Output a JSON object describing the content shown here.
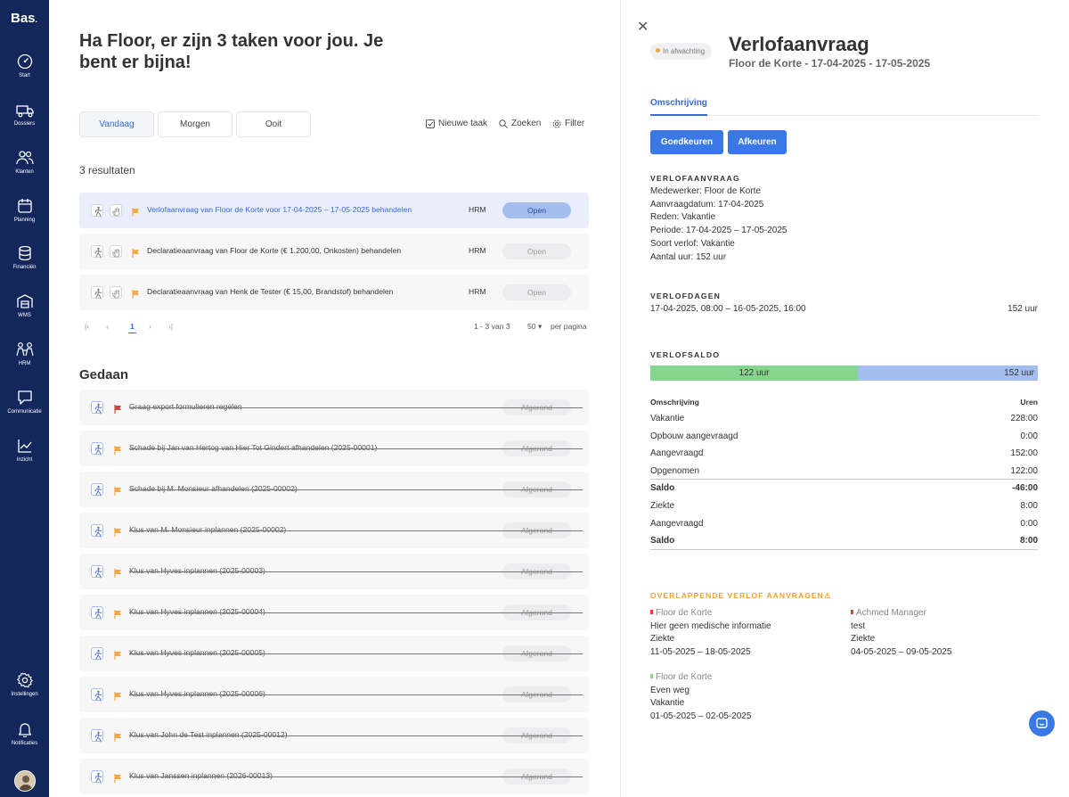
{
  "sidebar": {
    "logo": "Bas",
    "items": [
      {
        "label": "Start"
      },
      {
        "label": "Dossiers"
      },
      {
        "label": "Klanten"
      },
      {
        "label": "Planning"
      },
      {
        "label": "Financiën"
      },
      {
        "label": "WMS"
      },
      {
        "label": "HRM"
      },
      {
        "label": "Communicatie"
      },
      {
        "label": "Inzicht"
      }
    ],
    "bottom": [
      {
        "label": "Instellingen"
      },
      {
        "label": "Notificaties"
      }
    ]
  },
  "main": {
    "greeting": "Ha Floor, er zijn 3 taken voor jou. Je bent er bijna!",
    "tabs": [
      {
        "label": "Vandaag",
        "active": true
      },
      {
        "label": "Morgen",
        "active": false
      },
      {
        "label": "Ooit",
        "active": false
      }
    ],
    "tools": {
      "new_task": "Nieuwe taak",
      "search": "Zoeken",
      "filter": "Filter"
    },
    "results_label": "3 resultaten",
    "tasks": [
      {
        "title": "Verlofaanvraag van Floor de Korte voor 17-04-2025 – 17-05-2025 behandelen",
        "category": "HRM",
        "status": "Open",
        "selected": true
      },
      {
        "title": "Declaratieaanvraag van Floor de Korte (€ 1.200,00, Onkosten) behandelen",
        "category": "HRM",
        "status": "Open",
        "selected": false
      },
      {
        "title": "Declaratieaanvraag van Henk de Tester (€ 15,00, Brandstof) behandelen",
        "category": "HRM",
        "status": "Open",
        "selected": false
      }
    ],
    "pager": {
      "page": "1",
      "range": "1 - 3 van 3",
      "per_page": "50",
      "per_page_label": "per pagina"
    },
    "done_title": "Gedaan",
    "done": [
      {
        "title": "Graag export formulieren regelen",
        "status": "Afgerond",
        "flag": "#d9423a"
      },
      {
        "title": "Schade bij Jan van Hertog van Hier Tot Gindert afhandelen (2025-00001)",
        "status": "Afgerond",
        "flag": "#f5a94a"
      },
      {
        "title": "Schade bij M. Monsieur afhandelen (2025-00002)",
        "status": "Afgerond",
        "flag": "#f5a94a"
      },
      {
        "title": "Klus van M. Monsieur inplannen (2025-00002)",
        "status": "Afgerond",
        "flag": "#f5a94a"
      },
      {
        "title": "Klus van Hyves inplannen (2025-00003)",
        "status": "Afgerond",
        "flag": "#f5a94a"
      },
      {
        "title": "Klus van Hyves inplannen (2025-00004)",
        "status": "Afgerond",
        "flag": "#f5a94a"
      },
      {
        "title": "Klus van Hyves inplannen (2025-00005)",
        "status": "Afgerond",
        "flag": "#f5a94a"
      },
      {
        "title": "Klus van Hyves inplannen (2025-00006)",
        "status": "Afgerond",
        "flag": "#f5a94a"
      },
      {
        "title": "Klus van John de Test inplannen (2025-00012)",
        "status": "Afgerond",
        "flag": "#f5a94a"
      },
      {
        "title": "Klus van Janssen inplannen (2026-00013)",
        "status": "Afgerond",
        "flag": "#f5a94a"
      }
    ]
  },
  "panel": {
    "status": "In afwachting",
    "title": "Verlofaanvraag",
    "subtitle": "Floor de Korte - 17-04-2025 - 17-05-2025",
    "tab": "Omschrijving",
    "approve": "Goedkeuren",
    "reject": "Afkeuren",
    "request": {
      "heading": "VERLOFAANVRAAG",
      "lines": [
        "Medewerker: Floor de Korte",
        "Aanvraagdatum: 17-04-2025",
        "Reden: Vakantie",
        "Periode: 17-04-2025 – 17-05-2025",
        "Soort verlof: Vakantie",
        "Aantal uur: 152 uur"
      ]
    },
    "days": {
      "heading": "VERLOFDAGEN",
      "range": "17-04-2025, 08:00 – 16-05-2025, 16:00",
      "hours": "152 uur"
    },
    "balance": {
      "heading": "VERLOFSALDO",
      "bar_used_label": "122 uur",
      "bar_total_label": "152 uur",
      "bar_used_fraction": 0.535,
      "col_description": "Omschrijving",
      "col_hours": "Uren",
      "rows": [
        {
          "label": "Vakantie",
          "value": "228:00",
          "bold": false
        },
        {
          "label": "Opbouw aangevraagd",
          "value": "0:00",
          "bold": false
        },
        {
          "label": "Aangevraagd",
          "value": "152:00",
          "bold": false
        },
        {
          "label": "Opgenomen",
          "value": "122:00",
          "bold": false
        },
        {
          "label": "Saldo",
          "value": "-46:00",
          "bold": true
        },
        {
          "label": "Ziekte",
          "value": "8:00",
          "bold": false
        },
        {
          "label": "Aangevraagd",
          "value": "0:00",
          "bold": false
        },
        {
          "label": "Saldo",
          "value": "8:00",
          "bold": true
        }
      ]
    },
    "overlap": {
      "heading": "OVERLAPPENDE VERLOF AANVRAGEN",
      "items": [
        {
          "name": "Floor de Korte",
          "note": "Hier geen medische informatie",
          "type": "Ziekte",
          "period": "11-05-2025 – 18-05-2025",
          "dot": "#d9423a"
        },
        {
          "name": "Achmed Manager",
          "note": "test",
          "type": "Ziekte",
          "period": "04-05-2025 – 09-05-2025",
          "dot": "#d9423a"
        },
        {
          "name": "Floor de Korte",
          "note": "Even weg",
          "type": "Vakantie",
          "period": "01-05-2025 – 02-05-2025",
          "dot": "#86d58f"
        }
      ]
    }
  }
}
